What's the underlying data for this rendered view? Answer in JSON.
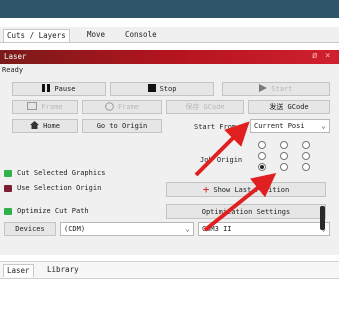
{
  "tabs": [
    "Cuts / Layers",
    "Move",
    "Console"
  ],
  "window": {
    "title": "Laser",
    "controls": [
      "ø",
      "×"
    ]
  },
  "status": "Ready",
  "row1": {
    "pause_label": "Pause",
    "stop_label": "Stop",
    "start_label": "Start"
  },
  "row2": {
    "frame1_label": "Frame",
    "frame2_label": "Frame",
    "save_gcode_label": "保存 GCode",
    "send_gcode_label": "发送 GCode"
  },
  "row3": {
    "home_label": "Home",
    "go_origin_label": "Go to Origin",
    "start_from_label": "Start From",
    "start_from_value": "Current Posi"
  },
  "job_origin_label": "Job Origin",
  "options": {
    "cut_selected": "Cut Selected Graphics",
    "use_selection_origin": "Use Selection Origin",
    "optimize_cut_path": "Optimize Cut Path"
  },
  "show_position_label": "Show Last Position",
  "optimization_label": "Optimization Settings",
  "devices": {
    "label": "Devices",
    "device_value": "(CDM)",
    "port_value": "COM3 II"
  },
  "bottom_tabs": [
    "Laser",
    "Library"
  ],
  "colors": {
    "titlebar": "#b4141e",
    "accent_green": "#2fb24a",
    "arrow": "#e02020"
  }
}
